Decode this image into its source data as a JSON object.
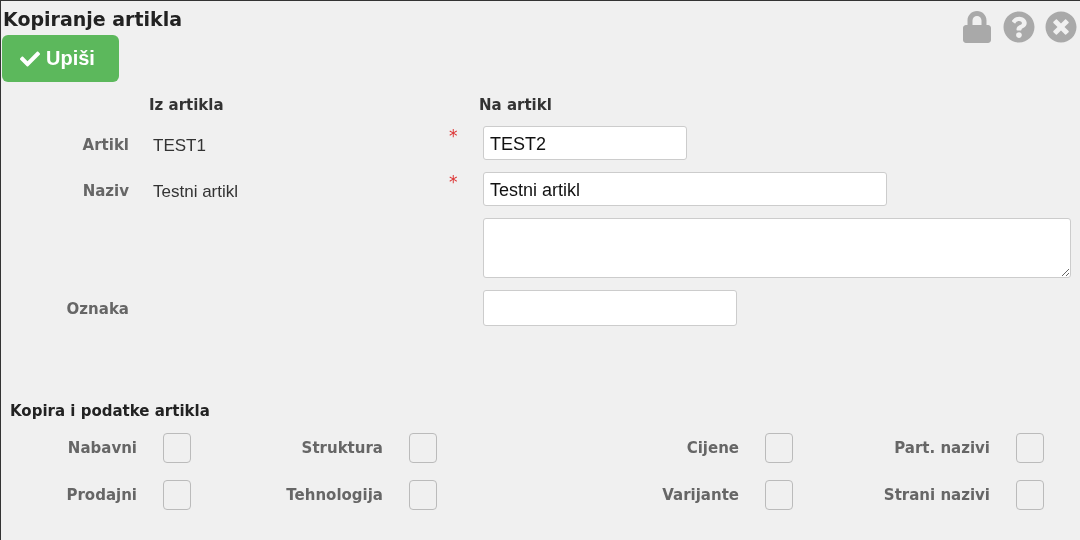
{
  "window": {
    "title": "Kopiranje artikla"
  },
  "save_button": {
    "label": "Upiši"
  },
  "form": {
    "from_heading": "Iz artikla",
    "to_heading": "Na artikl",
    "fields": [
      {
        "kind": "input",
        "label": "Artikl",
        "from": "TEST1",
        "required_marker": "*",
        "value": "TEST2"
      },
      {
        "kind": "input",
        "label": "Naziv",
        "from": "Testni artikl",
        "required_marker": "*",
        "value": "Testni artikl"
      },
      {
        "kind": "textarea"
      },
      {
        "kind": "input",
        "label": "Oznaka"
      }
    ]
  },
  "copy_section": {
    "title": "Kopira i podatke artikla",
    "options": [
      {
        "label": "Nabavni",
        "checked": false
      },
      {
        "label": "Struktura",
        "checked": false
      },
      {
        "label": "Cijene",
        "checked": false
      },
      {
        "label": "Part. nazivi",
        "checked": false
      },
      {
        "label": "Prodajni",
        "checked": false
      },
      {
        "label": "Tehnologija",
        "checked": false
      },
      {
        "label": "Varijante",
        "checked": false
      },
      {
        "label": "Strani nazivi",
        "checked": false
      }
    ]
  }
}
